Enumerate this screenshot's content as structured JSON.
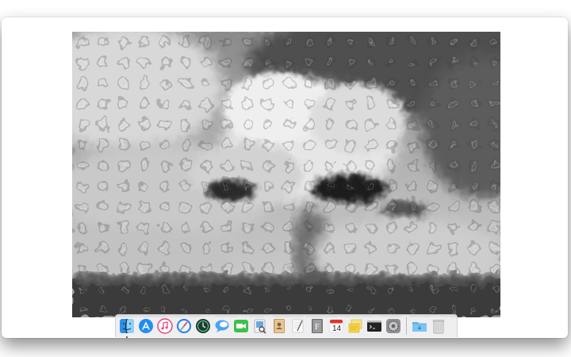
{
  "desktop": {
    "wallpaper": "grayscale-cloud-photo-glass-distortion"
  },
  "dock": {
    "items": [
      {
        "name": "finder",
        "icon": "finder-icon",
        "running": true
      },
      {
        "name": "app-store",
        "icon": "app-store-icon"
      },
      {
        "name": "itunes",
        "icon": "itunes-icon"
      },
      {
        "name": "safari",
        "icon": "safari-icon"
      },
      {
        "name": "time-machine",
        "icon": "time-machine-icon"
      },
      {
        "name": "messages",
        "icon": "messages-icon"
      },
      {
        "name": "facetime",
        "icon": "facetime-icon"
      },
      {
        "name": "preview",
        "icon": "preview-icon"
      },
      {
        "name": "contacts",
        "icon": "contacts-icon"
      },
      {
        "name": "textedit",
        "icon": "textedit-icon"
      },
      {
        "name": "font-book",
        "icon": "font-book-icon"
      },
      {
        "name": "calendar",
        "icon": "calendar-icon",
        "day": "14"
      },
      {
        "name": "stickies",
        "icon": "stickies-icon"
      },
      {
        "name": "terminal",
        "icon": "terminal-icon"
      },
      {
        "name": "system-preferences",
        "icon": "gear-icon"
      },
      {
        "name": "downloads-folder",
        "icon": "folder-icon"
      },
      {
        "name": "trash",
        "icon": "trash-icon"
      }
    ],
    "calendar_day": "14",
    "font_book_letter": "F"
  },
  "colors": {
    "app_store_blue": "#1f8ef1",
    "itunes_pink": "#e8457a",
    "safari_blue": "#2a7de1",
    "facetime_green": "#3cc24a",
    "calendar_red": "#e5322d",
    "stickies_yellow": "#f5d33c",
    "folder_blue": "#5fb1ea"
  }
}
